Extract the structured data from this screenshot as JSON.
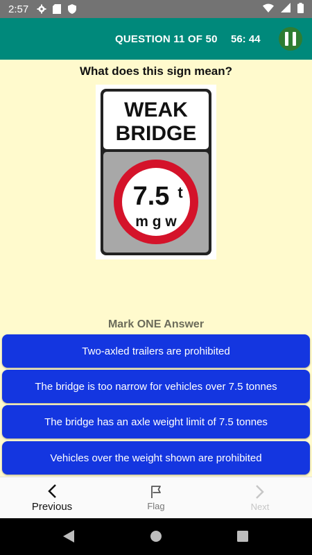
{
  "status_bar": {
    "time": "2:57",
    "icons": [
      "settings-icon",
      "sd-card-icon",
      "shield-icon",
      "wifi-icon",
      "signal-icon",
      "battery-icon"
    ]
  },
  "header": {
    "question_counter": "QUESTION 11 OF 50",
    "timer": "56: 44",
    "pause_icon": "pause-icon"
  },
  "question": {
    "text": "What does this sign mean?"
  },
  "sign": {
    "line1": "WEAK",
    "line2": "BRIDGE",
    "limit": "7.5",
    "unit": "t",
    "sub": "m g w"
  },
  "answers": {
    "heading": "Mark ONE Answer",
    "options": [
      "Two-axled trailers are prohibited",
      "The bridge is too narrow for vehicles over 7.5 tonnes",
      "The bridge has an axle weight limit of 7.5 tonnes",
      "Vehicles over the weight shown are prohibited"
    ]
  },
  "bottom_nav": {
    "previous": "Previous",
    "flag": "Flag",
    "next": "Next"
  },
  "colors": {
    "status_bar": "#737373",
    "header": "#00897B",
    "pause_button": "#2E7D32",
    "background": "#FFFACD",
    "answer_button": "#1436E0",
    "sign_red": "#D4132A"
  }
}
